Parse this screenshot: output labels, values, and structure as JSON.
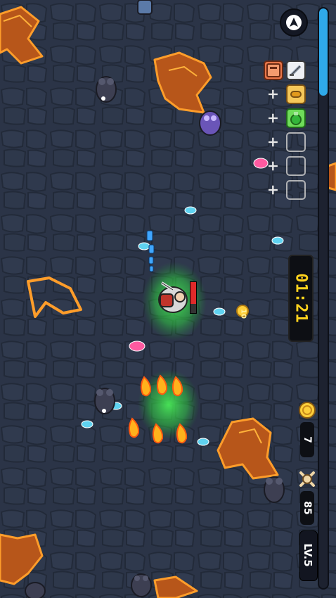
{
  "hud": {
    "timer": "01:21",
    "coins": "7",
    "kills": "85",
    "level": "LV.5",
    "xp_progress": 0.15,
    "pickup_text": "10"
  },
  "skill_slots": {
    "row1": [
      "spellbook-icon",
      "sword-icon"
    ],
    "row2": [
      "plus",
      "bullet-icon"
    ],
    "row3": [
      "plus",
      "green-potion-icon"
    ],
    "row4": [
      "plus",
      "empty"
    ],
    "row5": [
      "plus",
      "empty"
    ],
    "row6": [
      "plus",
      "empty"
    ]
  },
  "colors": {
    "timer": "#ffd21d",
    "xp_bar": "#2fa9ea",
    "lava": "#f08a1c",
    "ground": "#2b3447",
    "aura": "#3bd64a",
    "gem_blue": "#5fd2f0",
    "gem_pink": "#ff5aa0"
  }
}
